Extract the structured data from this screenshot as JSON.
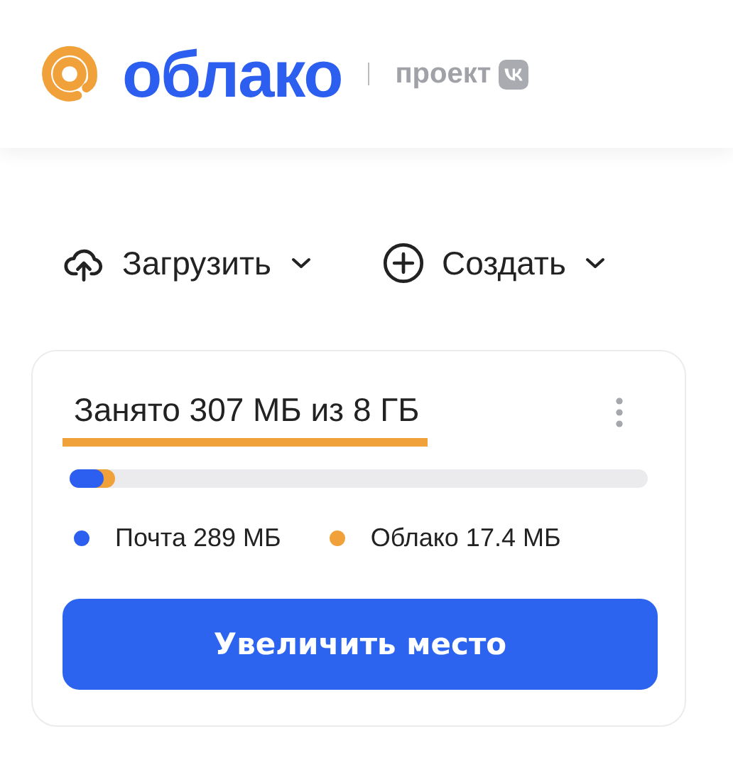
{
  "header": {
    "logo_text": "облако",
    "tagline": "проект"
  },
  "actions": [
    {
      "kind": "upload",
      "label": "Загрузить"
    },
    {
      "kind": "create",
      "label": "Создать"
    }
  ],
  "storage": {
    "title": "Занято 307 МБ из 8 ГБ",
    "segments": [
      {
        "name": "Почта 289 МБ",
        "level": 0.03,
        "color": "#2c5ff0"
      },
      {
        "name": "Облако 17.4 МБ",
        "level": 0.02,
        "color": "#f0a13a"
      }
    ],
    "button": "Увеличить место"
  }
}
